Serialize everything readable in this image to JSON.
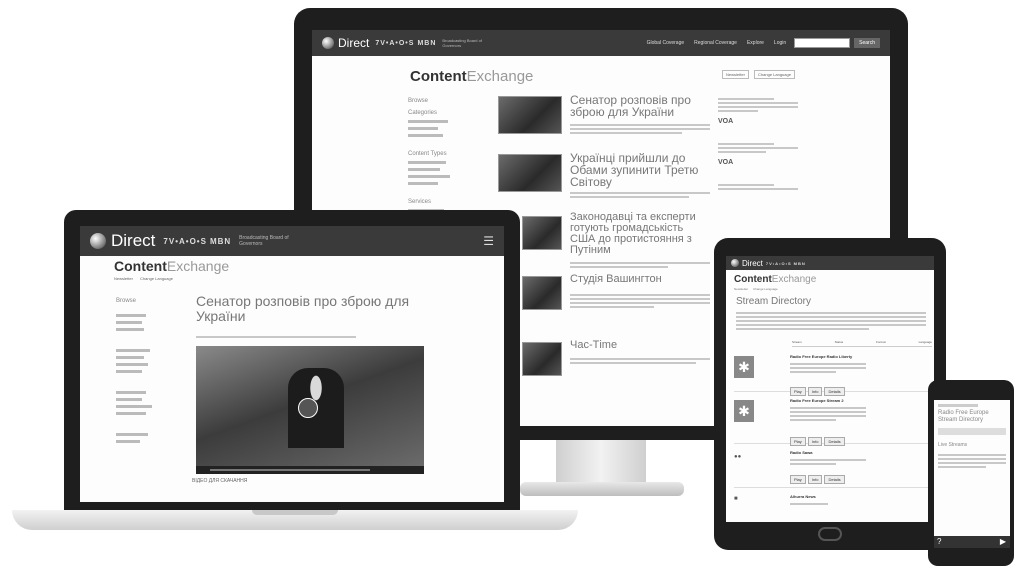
{
  "brand": {
    "direct": "Direct",
    "vaos": "7V•A•O•S",
    "mbn": "MBN",
    "partner_text": "Broadcasting Board of Governors"
  },
  "site": {
    "title_bold": "Content",
    "title_light": "Exchange"
  },
  "monitor": {
    "nav_items": [
      "Global Coverage",
      "Regional Coverage",
      "Explore",
      "Login"
    ],
    "search_button": "Search",
    "header_links": [
      "Newsletter",
      "Change Language"
    ],
    "sidebar": {
      "heading": "Browse",
      "groups": [
        {
          "title": "Categories",
          "lines": 3
        },
        {
          "title": "Content Types",
          "lines": 4
        },
        {
          "title": "Services",
          "lines": 3
        }
      ]
    },
    "stories": [
      {
        "headline": "Сенатор розповів про зброю для України"
      },
      {
        "headline": "Українці прийшли до Обами зупинити Третю Світову"
      },
      {
        "headline": "Законодавці та експерти готують громадськість США до протистояння з Путіним"
      },
      {
        "headline": "Студія Вашингтон"
      },
      {
        "headline": "Час-Тime"
      }
    ],
    "right_icon": "VOA"
  },
  "laptop": {
    "header_links": [
      "Newsletter",
      "Change Language"
    ],
    "sidebar_heading": "Browse",
    "article_title": "Сенатор розповів про зброю для України",
    "video_caption": "ВІДЕО ДЛЯ СКАЧАННЯ"
  },
  "tablet": {
    "header_links": [
      "Newsletter",
      "Change Language"
    ],
    "section_title": "Stream Directory",
    "table_headers": [
      "Stream",
      "Status",
      "Format",
      "Language"
    ],
    "rows": [
      {
        "title": "Radio Free Europe Radio Liberty",
        "buttons": [
          "Play",
          "Info",
          "Details"
        ]
      },
      {
        "title": "Radio Free Europe Stream 2",
        "buttons": [
          "Play",
          "Info",
          "Details"
        ]
      },
      {
        "title": "Radio Sawa",
        "buttons": [
          "Play",
          "Info",
          "Details"
        ]
      },
      {
        "title": "Alhurra News",
        "buttons": []
      }
    ]
  },
  "phone": {
    "title_line1": "Radio Free Europe",
    "title_line2": "Stream Directory",
    "section_title": "Live Streams"
  }
}
